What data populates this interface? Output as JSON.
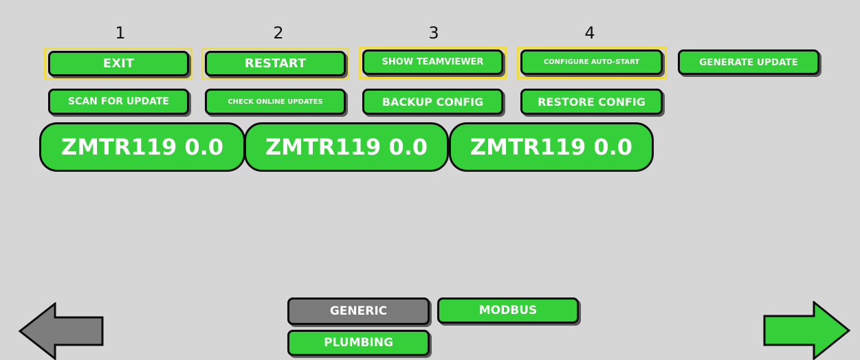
{
  "colors": {
    "button_green": "#35cf3a",
    "button_grey": "#7a7a7a",
    "highlight": "#f0dc3a",
    "background": "#d6d6d6"
  },
  "numbers": [
    "1",
    "2",
    "3",
    "4"
  ],
  "row1": {
    "exit": "EXIT",
    "restart": "RESTART",
    "show_teamviewer": "SHOW TEAMVIEWER",
    "configure_autostart": "CONFIGURE AUTO-START",
    "generate_update": "GENERATE UPDATE"
  },
  "row2": {
    "scan_for_update": "SCAN FOR UPDATE",
    "check_online_updates": "CHECK ONLINE UPDATES",
    "backup_config": "BACKUP CONFIG",
    "restore_config": "RESTORE CONFIG"
  },
  "versions": [
    "ZMTR119 0.0",
    "ZMTR119 0.0",
    "ZMTR119 0.0"
  ],
  "categories": {
    "generic": "GENERIC",
    "modbus": "MODBUS",
    "plumbing": "PLUMBING"
  },
  "nav": {
    "back_icon": "left-arrow-icon",
    "forward_icon": "right-arrow-icon"
  }
}
